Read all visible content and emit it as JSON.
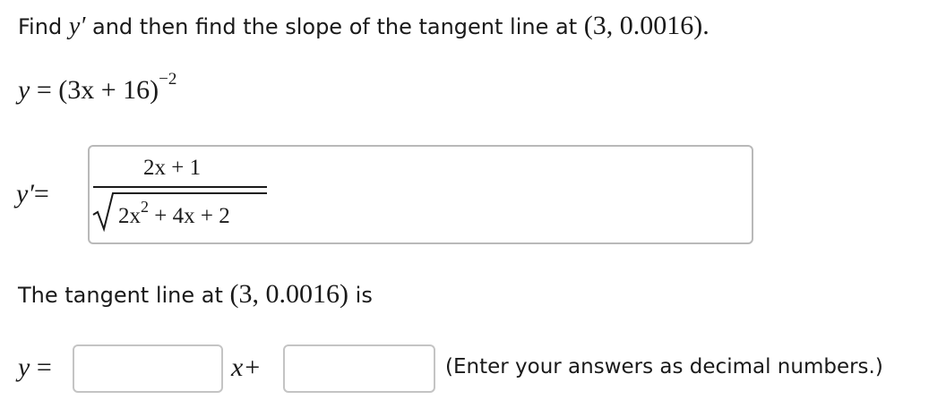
{
  "question": {
    "prefix": "Find ",
    "yprime": "y′",
    "middle": " and then find the slope of the tangent line at ",
    "point": "(3, 0.0016)",
    "suffix": "."
  },
  "function": {
    "lhs": "y",
    "eq": " = ",
    "base": "(3x + 16)",
    "exponent": "−2"
  },
  "derivative": {
    "label": "y′",
    "eq": "=",
    "answer": {
      "numerator": "2x + 1",
      "radicand_term1": "2x",
      "radicand_exp": "2",
      "radicand_rest": " + 4x + 2"
    }
  },
  "tangent": {
    "prefix": "The tangent line at ",
    "point": "(3, 0.0016)",
    "suffix": " is",
    "lhs": "y",
    "eq": " = ",
    "slope_value": "",
    "x_label": "x+",
    "intercept_value": "",
    "hint": "(Enter your answers as decimal numbers.)"
  }
}
